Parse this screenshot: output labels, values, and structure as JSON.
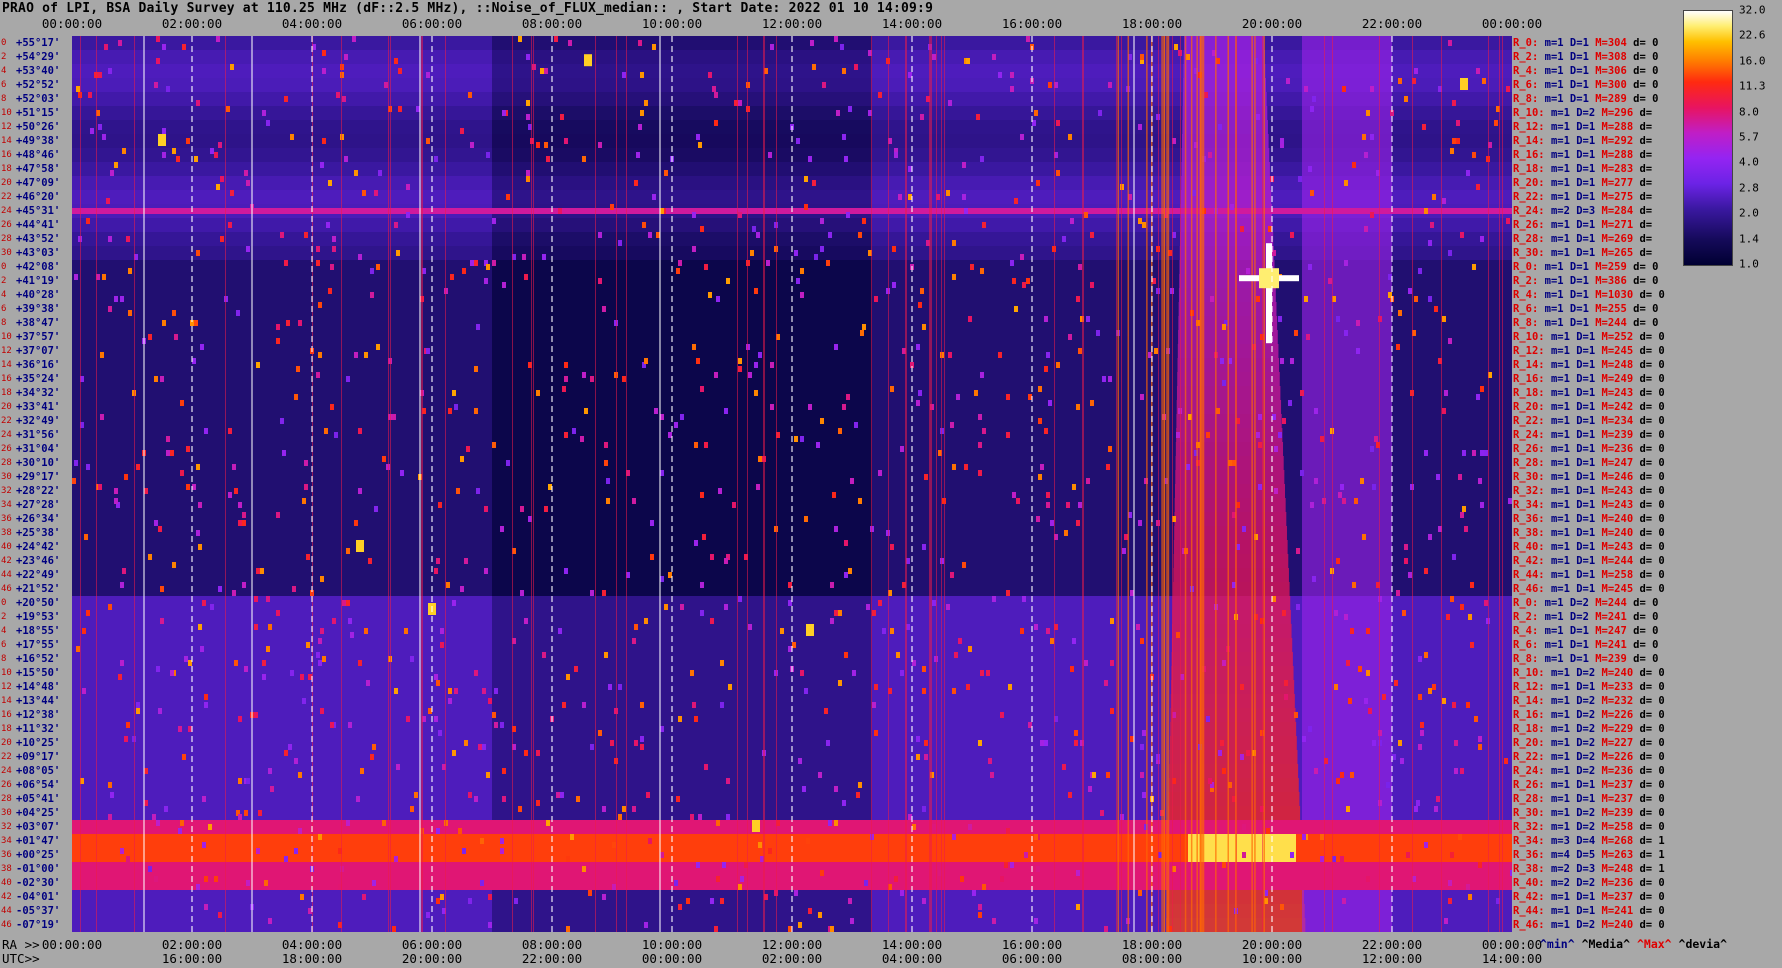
{
  "title": "PRAO of LPI, BSA Daily Survey at 110.25 MHz (dF::2.5 MHz), ::Noise_of_FLUX_median:: , Start Date: 2022 01 10 14:09:9",
  "axis_prefix": {
    "ra": "RA >>",
    "utc": "UTC>>"
  },
  "time_axis": {
    "top_labels": [
      "00:00:00",
      "02:00:00",
      "04:00:00",
      "06:00:00",
      "08:00:00",
      "10:00:00",
      "12:00:00",
      "14:00:00",
      "16:00:00",
      "18:00:00",
      "20:00:00",
      "22:00:00",
      "00:00:00"
    ],
    "ra_labels": [
      "00:00:00",
      "02:00:00",
      "04:00:00",
      "06:00:00",
      "08:00:00",
      "10:00:00",
      "12:00:00",
      "14:00:00",
      "16:00:00",
      "18:00:00",
      "20:00:00",
      "22:00:00",
      "00:00:00"
    ],
    "utc_labels": [
      "16:00:00",
      "18:00:00",
      "20:00:00",
      "22:00:00",
      "00:00:00",
      "02:00:00",
      "04:00:00",
      "06:00:00",
      "08:00:00",
      "10:00:00",
      "12:00:00",
      "14:00:00"
    ]
  },
  "dec_axis": {
    "labels": [
      "+55°17'",
      "+54°29'",
      "+53°40'",
      "+52°52'",
      "+52°03'",
      "+51°15'",
      "+50°26'",
      "+49°38'",
      "+48°46'",
      "+47°58'",
      "+47°09'",
      "+46°20'",
      "+45°31'",
      "+44°41'",
      "+43°52'",
      "+43°03'",
      "+42°08'",
      "+41°19'",
      "+40°28'",
      "+39°38'",
      "+38°47'",
      "+37°57'",
      "+37°07'",
      "+36°16'",
      "+35°24'",
      "+34°32'",
      "+33°41'",
      "+32°49'",
      "+31°56'",
      "+31°04'",
      "+30°10'",
      "+29°17'",
      "+28°22'",
      "+27°28'",
      "+26°34'",
      "+25°38'",
      "+24°42'",
      "+23°46'",
      "+22°49'",
      "+21°52'",
      "+20°50'",
      "+19°53'",
      "+18°55'",
      "+17°55'",
      "+16°52'",
      "+15°50'",
      "+14°48'",
      "+13°44'",
      "+12°38'",
      "+11°32'",
      "+10°25'",
      "+09°17'",
      "+08°05'",
      "+06°54'",
      "+05°41'",
      "+04°25'",
      "+03°07'",
      "+01°47'",
      "+00°25'",
      "-01°00'",
      "-02°30'",
      "-04°01'",
      "-05°37'",
      "-07°19'"
    ],
    "indices": [
      "0",
      "2",
      "4",
      "6",
      "8",
      "10",
      "12",
      "14",
      "16",
      "18",
      "20",
      "22",
      "24",
      "26",
      "28",
      "30",
      "0",
      "2",
      "4",
      "6",
      "8",
      "10",
      "12",
      "14",
      "16",
      "18",
      "20",
      "22",
      "24",
      "26",
      "28",
      "30",
      "32",
      "34",
      "36",
      "38",
      "40",
      "42",
      "44",
      "46",
      "0",
      "2",
      "4",
      "6",
      "8",
      "10",
      "12",
      "14",
      "16",
      "18",
      "20",
      "22",
      "24",
      "26",
      "28",
      "30",
      "32",
      "34",
      "36",
      "38",
      "40",
      "42",
      "44",
      "46"
    ]
  },
  "stats": [
    {
      "r": "R_0:",
      "m": "m=1",
      "d": "D=1",
      "x": "M=304",
      "dev": "d= 0"
    },
    {
      "r": "R_2:",
      "m": "m=1",
      "d": "D=1",
      "x": "M=308",
      "dev": "d= 0"
    },
    {
      "r": "R_4:",
      "m": "m=1",
      "d": "D=1",
      "x": "M=306",
      "dev": "d= 0"
    },
    {
      "r": "R_6:",
      "m": "m=1",
      "d": "D=1",
      "x": "M=300",
      "dev": "d= 0"
    },
    {
      "r": "R_8:",
      "m": "m=1",
      "d": "D=1",
      "x": "M=289",
      "dev": "d= 0"
    },
    {
      "r": "R_10:",
      "m": "m=1",
      "d": "D=2",
      "x": "M=296",
      "dev": "d="
    },
    {
      "r": "R_12:",
      "m": "m=1",
      "d": "D=1",
      "x": "M=288",
      "dev": "d="
    },
    {
      "r": "R_14:",
      "m": "m=1",
      "d": "D=1",
      "x": "M=292",
      "dev": "d="
    },
    {
      "r": "R_16:",
      "m": "m=1",
      "d": "D=1",
      "x": "M=288",
      "dev": "d="
    },
    {
      "r": "R_18:",
      "m": "m=1",
      "d": "D=1",
      "x": "M=283",
      "dev": "d="
    },
    {
      "r": "R_20:",
      "m": "m=1",
      "d": "D=1",
      "x": "M=277",
      "dev": "d="
    },
    {
      "r": "R_22:",
      "m": "m=1",
      "d": "D=1",
      "x": "M=275",
      "dev": "d="
    },
    {
      "r": "R_24:",
      "m": "m=2",
      "d": "D=3",
      "x": "M=284",
      "dev": "d="
    },
    {
      "r": "R_26:",
      "m": "m=1",
      "d": "D=1",
      "x": "M=271",
      "dev": "d="
    },
    {
      "r": "R_28:",
      "m": "m=1",
      "d": "D=1",
      "x": "M=269",
      "dev": "d="
    },
    {
      "r": "R_30:",
      "m": "m=1",
      "d": "D=1",
      "x": "M=265",
      "dev": "d="
    },
    {
      "r": "R_0:",
      "m": "m=1",
      "d": "D=1",
      "x": "M=259",
      "dev": "d= 0"
    },
    {
      "r": "R_2:",
      "m": "m=1",
      "d": "D=1",
      "x": "M=386",
      "dev": "d= 0"
    },
    {
      "r": "R_4:",
      "m": "m=1",
      "d": "D=1",
      "x": "M=1030",
      "dev": "d= 0"
    },
    {
      "r": "R_6:",
      "m": "m=1",
      "d": "D=1",
      "x": "M=255",
      "dev": "d= 0"
    },
    {
      "r": "R_8:",
      "m": "m=1",
      "d": "D=1",
      "x": "M=244",
      "dev": "d= 0"
    },
    {
      "r": "R_10:",
      "m": "m=1",
      "d": "D=1",
      "x": "M=252",
      "dev": "d= 0"
    },
    {
      "r": "R_12:",
      "m": "m=1",
      "d": "D=1",
      "x": "M=245",
      "dev": "d= 0"
    },
    {
      "r": "R_14:",
      "m": "m=1",
      "d": "D=1",
      "x": "M=248",
      "dev": "d= 0"
    },
    {
      "r": "R_16:",
      "m": "m=1",
      "d": "D=1",
      "x": "M=249",
      "dev": "d= 0"
    },
    {
      "r": "R_18:",
      "m": "m=1",
      "d": "D=1",
      "x": "M=243",
      "dev": "d= 0"
    },
    {
      "r": "R_20:",
      "m": "m=1",
      "d": "D=1",
      "x": "M=242",
      "dev": "d= 0"
    },
    {
      "r": "R_22:",
      "m": "m=1",
      "d": "D=1",
      "x": "M=234",
      "dev": "d= 0"
    },
    {
      "r": "R_24:",
      "m": "m=1",
      "d": "D=1",
      "x": "M=239",
      "dev": "d= 0"
    },
    {
      "r": "R_26:",
      "m": "m=1",
      "d": "D=1",
      "x": "M=236",
      "dev": "d= 0"
    },
    {
      "r": "R_28:",
      "m": "m=1",
      "d": "D=1",
      "x": "M=247",
      "dev": "d= 0"
    },
    {
      "r": "R_30:",
      "m": "m=1",
      "d": "D=1",
      "x": "M=246",
      "dev": "d= 0"
    },
    {
      "r": "R_32:",
      "m": "m=1",
      "d": "D=1",
      "x": "M=243",
      "dev": "d= 0"
    },
    {
      "r": "R_34:",
      "m": "m=1",
      "d": "D=1",
      "x": "M=243",
      "dev": "d= 0"
    },
    {
      "r": "R_36:",
      "m": "m=1",
      "d": "D=1",
      "x": "M=240",
      "dev": "d= 0"
    },
    {
      "r": "R_38:",
      "m": "m=1",
      "d": "D=1",
      "x": "M=240",
      "dev": "d= 0"
    },
    {
      "r": "R_40:",
      "m": "m=1",
      "d": "D=1",
      "x": "M=243",
      "dev": "d= 0"
    },
    {
      "r": "R_42:",
      "m": "m=1",
      "d": "D=1",
      "x": "M=244",
      "dev": "d= 0"
    },
    {
      "r": "R_44:",
      "m": "m=1",
      "d": "D=1",
      "x": "M=258",
      "dev": "d= 0"
    },
    {
      "r": "R_46:",
      "m": "m=1",
      "d": "D=1",
      "x": "M=245",
      "dev": "d= 0"
    },
    {
      "r": "R_0:",
      "m": "m=1",
      "d": "D=2",
      "x": "M=244",
      "dev": "d= 0"
    },
    {
      "r": "R_2:",
      "m": "m=1",
      "d": "D=2",
      "x": "M=241",
      "dev": "d= 0"
    },
    {
      "r": "R_4:",
      "m": "m=1",
      "d": "D=1",
      "x": "M=247",
      "dev": "d= 0"
    },
    {
      "r": "R_6:",
      "m": "m=1",
      "d": "D=1",
      "x": "M=241",
      "dev": "d= 0"
    },
    {
      "r": "R_8:",
      "m": "m=1",
      "d": "D=1",
      "x": "M=239",
      "dev": "d= 0"
    },
    {
      "r": "R_10:",
      "m": "m=1",
      "d": "D=2",
      "x": "M=240",
      "dev": "d= 0"
    },
    {
      "r": "R_12:",
      "m": "m=1",
      "d": "D=1",
      "x": "M=233",
      "dev": "d= 0"
    },
    {
      "r": "R_14:",
      "m": "m=1",
      "d": "D=2",
      "x": "M=232",
      "dev": "d= 0"
    },
    {
      "r": "R_16:",
      "m": "m=1",
      "d": "D=2",
      "x": "M=226",
      "dev": "d= 0"
    },
    {
      "r": "R_18:",
      "m": "m=1",
      "d": "D=2",
      "x": "M=229",
      "dev": "d= 0"
    },
    {
      "r": "R_20:",
      "m": "m=1",
      "d": "D=2",
      "x": "M=227",
      "dev": "d= 0"
    },
    {
      "r": "R_22:",
      "m": "m=1",
      "d": "D=2",
      "x": "M=226",
      "dev": "d= 0"
    },
    {
      "r": "R_24:",
      "m": "m=1",
      "d": "D=2",
      "x": "M=236",
      "dev": "d= 0"
    },
    {
      "r": "R_26:",
      "m": "m=1",
      "d": "D=1",
      "x": "M=237",
      "dev": "d= 0"
    },
    {
      "r": "R_28:",
      "m": "m=1",
      "d": "D=1",
      "x": "M=237",
      "dev": "d= 0"
    },
    {
      "r": "R_30:",
      "m": "m=1",
      "d": "D=2",
      "x": "M=239",
      "dev": "d= 0"
    },
    {
      "r": "R_32:",
      "m": "m=1",
      "d": "D=2",
      "x": "M=258",
      "dev": "d= 0"
    },
    {
      "r": "R_34:",
      "m": "m=3",
      "d": "D=4",
      "x": "M=268",
      "dev": "d= 1"
    },
    {
      "r": "R_36:",
      "m": "m=4",
      "d": "D=5",
      "x": "M=263",
      "dev": "d= 1"
    },
    {
      "r": "R_38:",
      "m": "m=2",
      "d": "D=3",
      "x": "M=248",
      "dev": "d= 1"
    },
    {
      "r": "R_40:",
      "m": "m=2",
      "d": "D=2",
      "x": "M=236",
      "dev": "d= 0"
    },
    {
      "r": "R_42:",
      "m": "m=1",
      "d": "D=1",
      "x": "M=237",
      "dev": "d= 0"
    },
    {
      "r": "R_44:",
      "m": "m=1",
      "d": "D=1",
      "x": "M=241",
      "dev": "d= 0"
    },
    {
      "r": "R_46:",
      "m": "m=1",
      "d": "D=2",
      "x": "M=240",
      "dev": "d= 0"
    }
  ],
  "colorbar": {
    "ticks": [
      "32.0",
      "22.6",
      "16.0",
      "11.3",
      "8.0",
      "5.7",
      "4.0",
      "2.8",
      "2.0",
      "1.4",
      "1.0"
    ]
  },
  "legend": {
    "min": "^min^",
    "med": "^Media^",
    "max": "^Max^",
    "dev": "^devia^"
  },
  "colors": {
    "label_red": "#e00000",
    "label_navy": "#000080",
    "background": "#a8a8a8"
  },
  "chart_data": {
    "type": "heatmap",
    "title": "PRAO of LPI, BSA Daily Survey at 110.25 MHz (dF::2.5 MHz), ::Noise_of_FLUX_median:: , Start Date: 2022 01 10 14:09:9",
    "x_axis": {
      "type": "time",
      "ra_range_hours": [
        0,
        24
      ],
      "tick_step_hours": 2
    },
    "y_axis": {
      "type": "declination",
      "range": [
        "+55°17'",
        "-07°19'"
      ],
      "rows": 64
    },
    "color_scale": {
      "type": "log",
      "range": [
        1.0,
        32.0
      ]
    },
    "features": [
      {
        "label": "horizontal band near declination +45°31'",
        "level": 5.7
      },
      {
        "label": "bright equatorial band around +01°47' to -01°00'",
        "level": 11.3
      },
      {
        "label": "bright compact source near RA 20h, +41°19'",
        "level": 32.0
      },
      {
        "label": "galactic plane emission around RA 19h-21h",
        "level": 8.0
      }
    ]
  }
}
